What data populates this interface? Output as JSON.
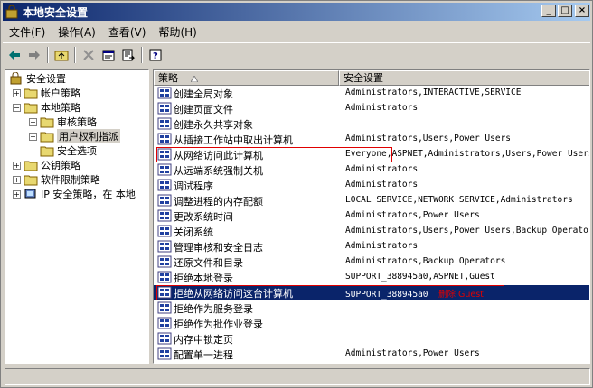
{
  "window": {
    "title": "本地安全设置"
  },
  "titlebar_buttons": [
    "_",
    "□",
    "×"
  ],
  "menu": [
    "文件(F)",
    "操作(A)",
    "查看(V)",
    "帮助(H)"
  ],
  "toolbar": [
    "back-icon",
    "forward-icon",
    "up-folder-icon",
    "delete-icon",
    "properties-icon",
    "export-icon",
    "help-icon"
  ],
  "tree": [
    {
      "label": "安全设置",
      "indent": 0,
      "pm": ""
    },
    {
      "label": "帐户策略",
      "indent": 1,
      "pm": "+"
    },
    {
      "label": "本地策略",
      "indent": 1,
      "pm": "−"
    },
    {
      "label": "审核策略",
      "indent": 2,
      "pm": "+"
    },
    {
      "label": "用户权利指派",
      "indent": 2,
      "pm": "+"
    },
    {
      "label": "安全选项",
      "indent": 2,
      "pm": ""
    },
    {
      "label": "公钥策略",
      "indent": 1,
      "pm": "+"
    },
    {
      "label": "软件限制策略",
      "indent": 1,
      "pm": "+"
    },
    {
      "label": "IP 安全策略，在 本地",
      "indent": 1,
      "pm": "+"
    }
  ],
  "list": {
    "columns": [
      "策略",
      "安全设置"
    ],
    "rows": [
      {
        "policy": "创建全局对象",
        "setting": "Administrators,INTERACTIVE,SERVICE"
      },
      {
        "policy": "创建页面文件",
        "setting": "Administrators"
      },
      {
        "policy": "创建永久共享对象",
        "setting": ""
      },
      {
        "policy": "从插接工作站中取出计算机",
        "setting": "Administrators,Users,Power Users"
      },
      {
        "policy": "从网络访问此计算机",
        "setting": "Everyone,ASPNET,Administrators,Users,Power Users,Backup Operators"
      },
      {
        "policy": "从远端系统强制关机",
        "setting": "Administrators"
      },
      {
        "policy": "调试程序",
        "setting": "Administrators"
      },
      {
        "policy": "调整进程的内存配额",
        "setting": "LOCAL SERVICE,NETWORK SERVICE,Administrators"
      },
      {
        "policy": "更改系统时间",
        "setting": "Administrators,Power Users"
      },
      {
        "policy": "关闭系统",
        "setting": "Administrators,Users,Power Users,Backup Operators"
      },
      {
        "policy": "管理审核和安全日志",
        "setting": "Administrators"
      },
      {
        "policy": "还原文件和目录",
        "setting": "Administrators,Backup Operators"
      },
      {
        "policy": "拒绝本地登录",
        "setting": "SUPPORT_388945a0,ASPNET,Guest"
      },
      {
        "policy": "拒绝从网络访问这台计算机",
        "setting": "SUPPORT_388945a0",
        "extra": "删除 Guest"
      },
      {
        "policy": "拒绝作为服务登录",
        "setting": ""
      },
      {
        "policy": "拒绝作为批作业登录",
        "setting": ""
      },
      {
        "policy": "内存中锁定页",
        "setting": ""
      },
      {
        "policy": "配置单一进程",
        "setting": "Administrators,Power Users"
      }
    ]
  },
  "colors": {
    "selection": "#0a246a",
    "annotation": "#e00000"
  }
}
